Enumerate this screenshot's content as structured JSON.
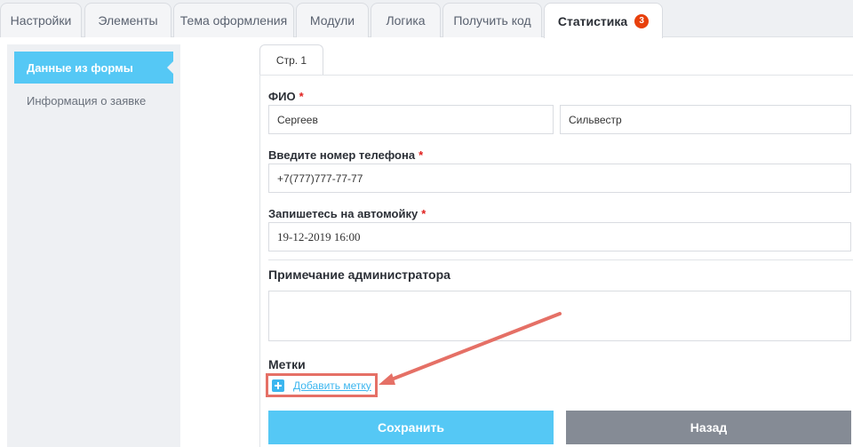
{
  "tabs": [
    {
      "label": "Настройки"
    },
    {
      "label": "Элементы"
    },
    {
      "label": "Тема оформления"
    },
    {
      "label": "Модули"
    },
    {
      "label": "Логика"
    },
    {
      "label": "Получить код"
    },
    {
      "label": "Статистика",
      "badge": "3",
      "active": true
    }
  ],
  "sidebar": {
    "items": [
      {
        "label": "Данные из формы",
        "active": true
      },
      {
        "label": "Информация о заявке"
      }
    ]
  },
  "page_tab": "Стр. 1",
  "form": {
    "fio_label": "ФИО",
    "required_mark": "*",
    "last_name": "Сергеев",
    "first_name": "Сильвестр",
    "phone_label": "Введите номер телефона",
    "phone_value": "+7(777)777-77-77",
    "booking_label": "Запишетесь на автомойку",
    "booking_value": "19-12-2019 16:00"
  },
  "admin_note": {
    "heading": "Примечание администратора",
    "value": ""
  },
  "tags": {
    "heading": "Метки",
    "add_label": "Добавить метку"
  },
  "buttons": {
    "save": "Сохранить",
    "back": "Назад"
  },
  "colors": {
    "accent": "#55c8f5",
    "badge": "#e8400c",
    "annotation": "#e57066",
    "back_button": "#858b95"
  }
}
